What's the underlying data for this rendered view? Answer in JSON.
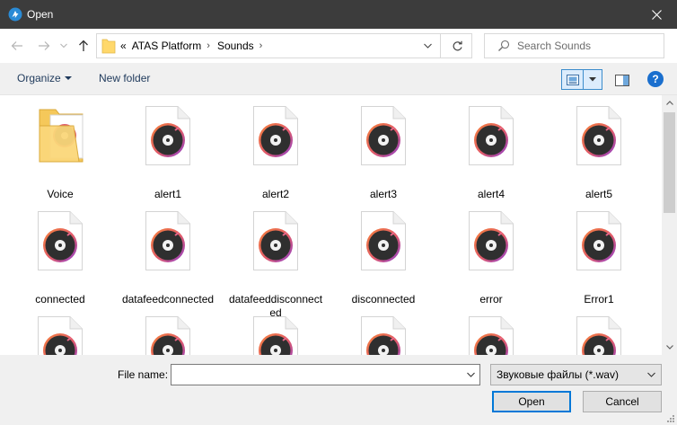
{
  "window": {
    "title": "Open",
    "icon": "atas-app-icon",
    "close_icon": "close-icon"
  },
  "nav": {
    "back_icon": "back-arrow-icon",
    "forward_icon": "forward-arrow-icon",
    "up_icon": "up-arrow-icon"
  },
  "address": {
    "overflow": "«",
    "crumbs": [
      "ATAS Platform",
      "Sounds"
    ]
  },
  "search": {
    "placeholder": "Search Sounds"
  },
  "toolbar": {
    "organize_label": "Organize",
    "new_folder_label": "New folder",
    "help_label": "?"
  },
  "files": [
    {
      "name": "Voice",
      "type": "folder"
    },
    {
      "name": "alert1",
      "type": "audio"
    },
    {
      "name": "alert2",
      "type": "audio"
    },
    {
      "name": "alert3",
      "type": "audio"
    },
    {
      "name": "alert4",
      "type": "audio"
    },
    {
      "name": "alert5",
      "type": "audio"
    },
    {
      "name": "connected",
      "type": "audio"
    },
    {
      "name": "datafeedconnected",
      "type": "audio"
    },
    {
      "name": "datafeeddisconnected",
      "type": "audio"
    },
    {
      "name": "disconnected",
      "type": "audio"
    },
    {
      "name": "error",
      "type": "audio"
    },
    {
      "name": "Error1",
      "type": "audio"
    },
    {
      "name": "",
      "type": "audio"
    },
    {
      "name": "",
      "type": "audio"
    },
    {
      "name": "",
      "type": "audio"
    },
    {
      "name": "",
      "type": "audio"
    },
    {
      "name": "",
      "type": "audio"
    },
    {
      "name": "",
      "type": "audio"
    }
  ],
  "footer": {
    "file_name_label": "File name:",
    "file_name_value": "",
    "file_type_selected": "Звуковые файлы (*.wav)",
    "open_label": "Open",
    "cancel_label": "Cancel"
  },
  "colors": {
    "accent": "#0078d7",
    "titlebar": "#3c3c3c",
    "disc_ring_start": "#f07a3a",
    "disc_ring_end": "#8a3fd1"
  }
}
